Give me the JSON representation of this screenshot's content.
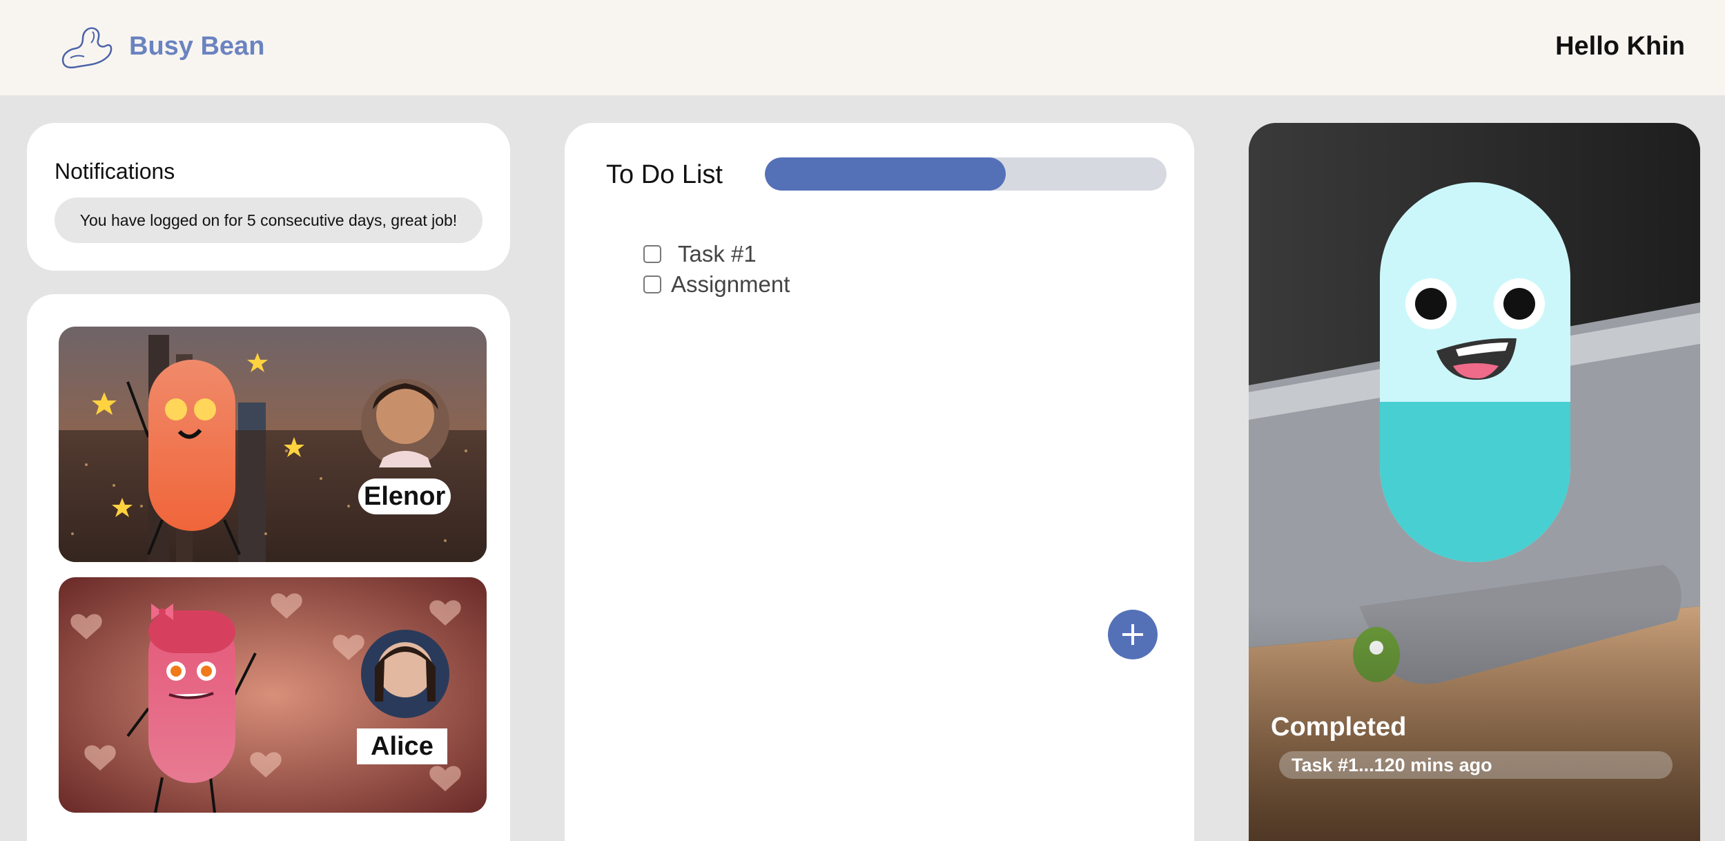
{
  "header": {
    "brand": "Busy Bean",
    "greeting": "Hello Khin"
  },
  "notifications": {
    "title": "Notifications",
    "message": "You have logged on for 5 consecutive days, great job!"
  },
  "friends": [
    {
      "name": "Elenor"
    },
    {
      "name": "Alice"
    }
  ],
  "todo": {
    "title": "To Do List",
    "progress_fraction": 0.6,
    "tasks": [
      {
        "label": "Task #1",
        "checked": false
      },
      {
        "label": "Assignment",
        "checked": false
      }
    ],
    "add_icon": "plus-icon"
  },
  "completed": {
    "title": "Completed",
    "item": "Task #1...120 mins ago"
  },
  "colors": {
    "accent": "#5471b8",
    "brand": "#6b83c0",
    "header_bg": "#f8f5f1",
    "page_bg": "#e4e4e4"
  }
}
